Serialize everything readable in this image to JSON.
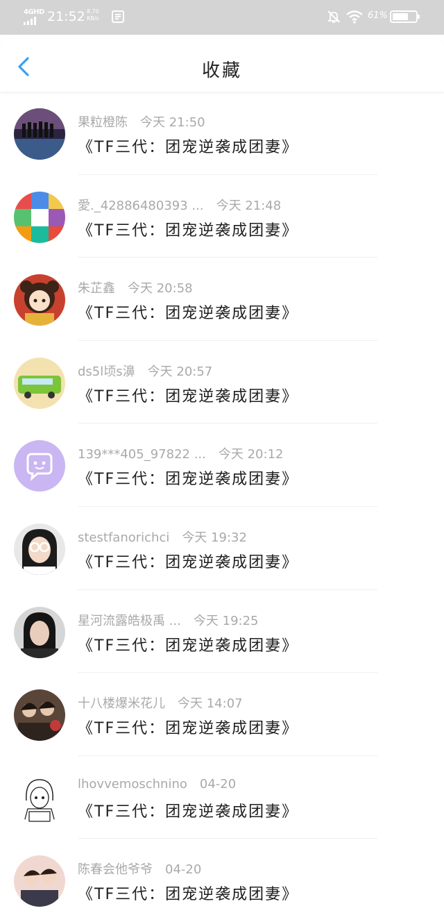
{
  "status_bar": {
    "network": "4GHD",
    "time": "21:52",
    "speed_value": "8.70",
    "speed_unit": "KB/s",
    "battery": "61%",
    "icons": [
      "signal-icon",
      "mail-icon",
      "mute-icon",
      "wifi-icon",
      "battery-icon"
    ]
  },
  "header": {
    "title": "收藏",
    "back_icon": "chevron-left-icon",
    "accent_color": "#3a9ff0"
  },
  "favorites": [
    {
      "user": "果粒橙陈",
      "time": "今天 21:50",
      "content": "《TF三代：团宠逆袭成团妻》",
      "avatar": "group-silhouette-avatar"
    },
    {
      "user": "愛._42886480393 ...",
      "time": "今天 21:48",
      "content": "《TF三代：团宠逆袭成团妻》",
      "avatar": "collage-avatar"
    },
    {
      "user": "朱芷鑫",
      "time": "今天 20:58",
      "content": "《TF三代：团宠逆袭成团妻》",
      "avatar": "cartoon-girl-avatar"
    },
    {
      "user": "ds5l顷s濞",
      "time": "今天 20:57",
      "content": "《TF三代：团宠逆袭成团妻》",
      "avatar": "green-bus-avatar"
    },
    {
      "user": "139***405_97822 ...",
      "time": "今天 20:12",
      "content": "《TF三代：团宠逆袭成团妻》",
      "avatar": "default-chat-avatar"
    },
    {
      "user": "stestfanorichci",
      "time": "今天 19:32",
      "content": "《TF三代：团宠逆袭成团妻》",
      "avatar": "girl-glasses-avatar"
    },
    {
      "user": "星河流露皓极禹 ...",
      "time": "今天 19:25",
      "content": "《TF三代：团宠逆袭成团妻》",
      "avatar": "dark-hair-girl-avatar"
    },
    {
      "user": "十八楼爆米花儿",
      "time": "今天 14:07",
      "content": "《TF三代：团宠逆袭成团妻》",
      "avatar": "group-photo-avatar"
    },
    {
      "user": "lhovvemoschnino",
      "time": "04-20",
      "content": "《TF三代：团宠逆袭成团妻》",
      "avatar": "sketch-girl-avatar"
    },
    {
      "user": "陈春会他爷爷",
      "time": "04-20",
      "content": "《TF三代：团宠逆袭成团妻》",
      "avatar": "two-boys-avatar"
    }
  ]
}
